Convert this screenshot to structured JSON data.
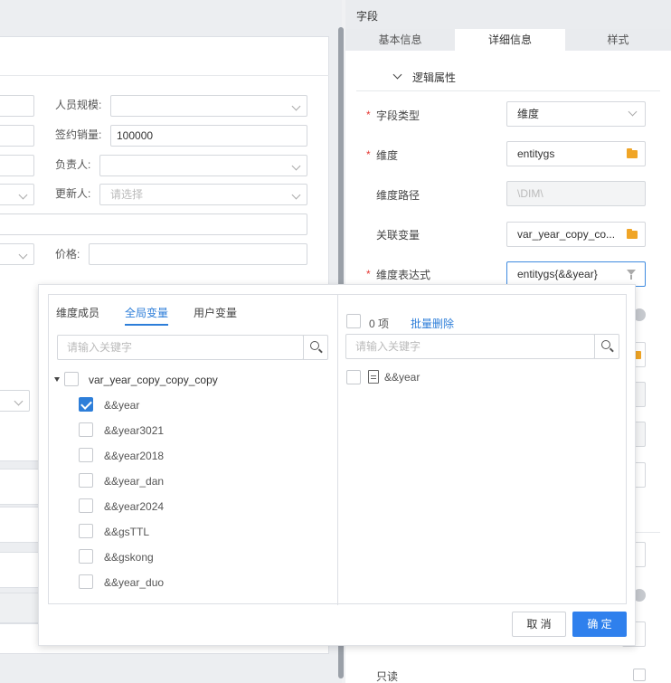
{
  "form": {
    "staff_scale_label": "人员规模:",
    "signed_sales_label": "签约销量:",
    "signed_sales_value": "100000",
    "owner_label": "负责人:",
    "updater_label": "更新人:",
    "updater_placeholder": "请选择",
    "price_label": "价格:"
  },
  "panel": {
    "header_title": "字段",
    "tabs": [
      {
        "label": "基本信息"
      },
      {
        "label": "详细信息"
      },
      {
        "label": "样式"
      }
    ],
    "section_title": "逻辑属性",
    "fields": {
      "field_type": {
        "label": "字段类型",
        "value": "维度"
      },
      "dimension": {
        "label": "维度",
        "value": "entitygs"
      },
      "dimension_path": {
        "label": "维度路径",
        "value": "\\DIM\\"
      },
      "linked_variable": {
        "label": "关联变量",
        "value": "var_year_copy_co..."
      },
      "dimension_expression": {
        "label": "维度表达式",
        "value": "entitygs{&&year}"
      }
    },
    "readonly_label": "只读"
  },
  "popup": {
    "tabs": [
      {
        "label": "维度成员"
      },
      {
        "label": "全局变量"
      },
      {
        "label": "用户变量"
      }
    ],
    "left_search_placeholder": "请输入关键字",
    "tree_root": "var_year_copy_copy_copy",
    "tree_items": [
      {
        "label": "&&year",
        "checked": true
      },
      {
        "label": "&&year3021",
        "checked": false
      },
      {
        "label": "&&year2018",
        "checked": false
      },
      {
        "label": "&&year_dan",
        "checked": false
      },
      {
        "label": "&&year2024",
        "checked": false
      },
      {
        "label": "&&gsTTL",
        "checked": false
      },
      {
        "label": "&&gskong",
        "checked": false
      },
      {
        "label": "&&year_duo",
        "checked": false
      }
    ],
    "count_label": "0 项",
    "bulk_delete": "批量删除",
    "right_search_placeholder": "请输入关键字",
    "selected_items": [
      {
        "label": "&&year"
      }
    ],
    "cancel": "取 消",
    "ok": "确 定"
  },
  "colors": {
    "accent": "#2d7ed9",
    "required": "#e53935",
    "folder": "#f0a526"
  }
}
